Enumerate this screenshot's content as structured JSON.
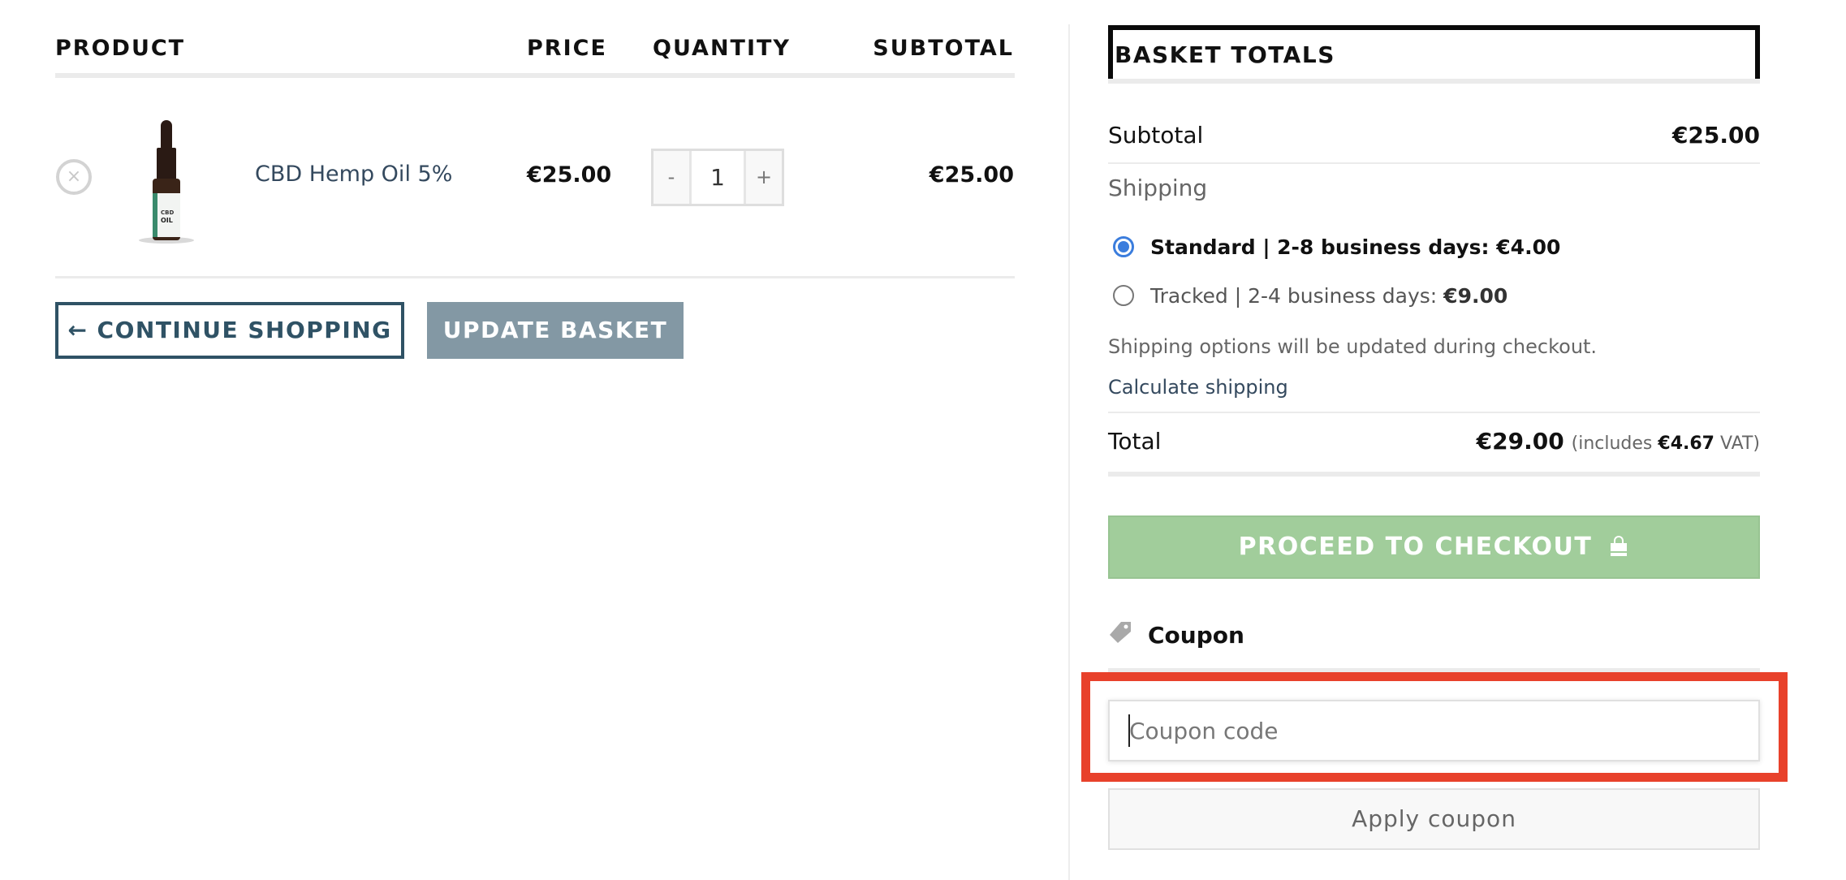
{
  "cart_table": {
    "headers": {
      "product": "PRODUCT",
      "price": "PRICE",
      "quantity": "QUANTITY",
      "subtotal": "SUBTOTAL"
    },
    "items": [
      {
        "remove_icon": "×",
        "image": "cbd-oil-bottle",
        "name": "CBD Hemp Oil 5%",
        "price": "€25.00",
        "quantity": "1",
        "subtotal": "€25.00"
      }
    ],
    "stepper": {
      "minus": "-",
      "plus": "+"
    }
  },
  "actions": {
    "continue_shopping": "← CONTINUE SHOPPING",
    "update_basket": "UPDATE BASKET"
  },
  "totals": {
    "title": "BASKET TOTALS",
    "subtotal_label": "Subtotal",
    "subtotal_value": "€25.00",
    "shipping_label": "Shipping",
    "shipping_options": [
      {
        "label": "Standard | 2-8 business days:",
        "price": "€4.00",
        "selected": true
      },
      {
        "label": "Tracked | 2-4 business days:",
        "price": "€9.00",
        "selected": false
      }
    ],
    "shipping_note": "Shipping options will be updated during checkout.",
    "calculate_shipping": "Calculate shipping",
    "total_label": "Total",
    "total_value": "€29.00",
    "vat_prefix": "(includes",
    "vat_value": "€4.67",
    "vat_suffix": "VAT)",
    "checkout_label": "PROCEED TO CHECKOUT"
  },
  "coupon": {
    "title": "Coupon",
    "input_value": "",
    "input_placeholder": "Coupon code",
    "apply_label": "Apply coupon"
  },
  "colors": {
    "checkout_green": "#a1cd9b",
    "update_gray": "#8398a4",
    "continue_navy": "#2f5265",
    "highlight_red": "#e8412b",
    "radio_blue": "#3b7ddd"
  }
}
